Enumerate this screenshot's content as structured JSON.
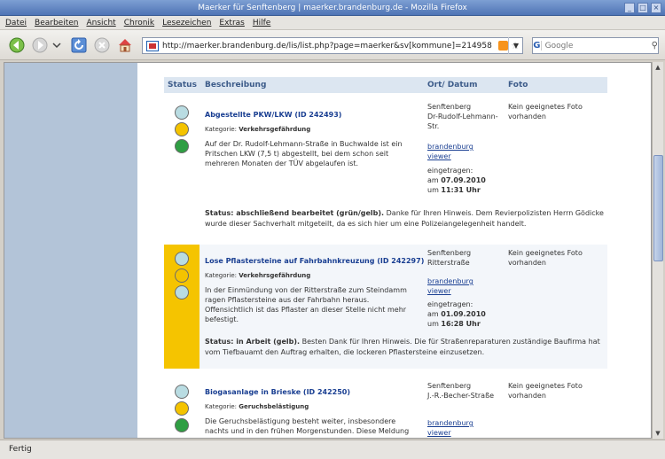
{
  "window": {
    "title": "Maerker für Senftenberg | maerker.brandenburg.de - Mozilla Firefox"
  },
  "menu": [
    "Datei",
    "Bearbeiten",
    "Ansicht",
    "Chronik",
    "Lesezeichen",
    "Extras",
    "Hilfe"
  ],
  "nav": {
    "url": "http://maerker.brandenburg.de/lis/list.php?page=maerker&sv[kommune]=214958",
    "search_placeholder": "Google",
    "search_engine": "G"
  },
  "table": {
    "headers": {
      "status": "Status",
      "beschreibung": "Beschreibung",
      "ort": "Ort/ Datum",
      "foto": "Foto"
    }
  },
  "entries": [
    {
      "title": "Abgestellte PKW/LKW (ID 242493)",
      "category_label": "Kategorie:",
      "category": "Verkehrsgefährdung",
      "description": "Auf der Dr. Rudolf-Lehmann-Straße in Buchwalde ist ein Pritschen LKW (7,5 t) abgestellt, bei dem schon seit mehreren Monaten der TÜV abgelaufen ist.",
      "location_city": "Senftenberg",
      "location_street": "Dr-Rudolf-Lehmann-Str.",
      "map_link": "brandenburg viewer",
      "date_label": "eingetragen:",
      "date": "am 07.09.2010",
      "time": "um 11:31 Uhr",
      "foto": "Kein geeignetes Foto vorhanden",
      "status_label": "Status: abschließend bearbeitet (grün/gelb).",
      "status_text": "Danke für Ihren Hinweis. Dem Revierpolizisten Herrn Gödicke wurde dieser Sachverhalt mitgeteilt, da es sich hier um eine Polizeiangelegenheit handelt.",
      "light": "green"
    },
    {
      "title": "Lose Pflastersteine auf Fahrbahnkreuzung (ID 242297)",
      "category_label": "Kategorie:",
      "category": "Verkehrsgefährdung",
      "description": "In der Einmündung von der Ritterstraße zum Steindamm ragen Pflastersteine aus der Fahrbahn heraus. Offensichtlich ist das Pflaster an dieser Stelle nicht mehr befestigt.",
      "location_city": "Senftenberg",
      "location_street": "Ritterstraße",
      "map_link": "brandenburg viewer",
      "date_label": "eingetragen:",
      "date": "am 01.09.2010",
      "time": "um 16:28 Uhr",
      "foto": "Kein geeignetes Foto vorhanden",
      "status_label": "Status: in Arbeit (gelb).",
      "status_text": "Besten Dank für Ihren Hinweis. Die für Straßenreparaturen zuständige Baufirma hat vom Tiefbauamt den Auftrag erhalten, die lockeren Pflastersteine einzusetzen.",
      "light": "yellow"
    },
    {
      "title": "Biogasanlage in Brieske (ID 242250)",
      "category_label": "Kategorie:",
      "category": "Geruchsbelästigung",
      "description": "Die Geruchsbelästigung besteht weiter, insbesondere nachts und in den frühen Morgenstunden. Diese Meldung",
      "location_city": "Senftenberg",
      "location_street": "J.-R.-Becher-Straße",
      "map_link": "brandenburg viewer",
      "foto": "Kein geeignetes Foto vorhanden",
      "light": "green"
    }
  ],
  "statusbar": {
    "text": "Fertig"
  },
  "colors": {
    "yellow_highlight": "#f5c400",
    "link": "#1a3f92",
    "header_bg": "#dce6f1",
    "sidebar": "#b3c4d8"
  }
}
